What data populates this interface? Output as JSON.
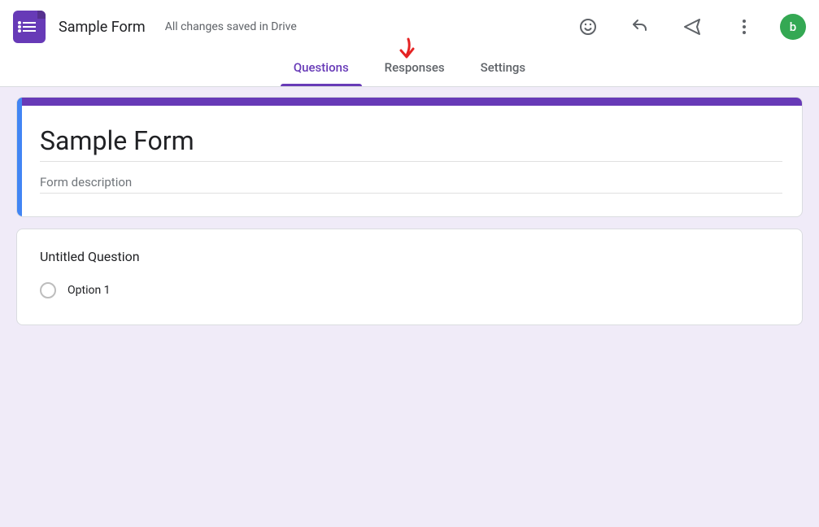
{
  "header": {
    "form_name": "Sample Form",
    "save_status": "All changes saved in Drive",
    "avatar_letter": "b"
  },
  "tabs": {
    "questions": "Questions",
    "responses": "Responses",
    "settings": "Settings"
  },
  "title_card": {
    "title": "Sample Form",
    "description_placeholder": "Form description"
  },
  "question_card": {
    "title": "Untitled Question",
    "option1": "Option 1"
  },
  "colors": {
    "primary": "#673ab7",
    "accent": "#4285f4",
    "avatar": "#34a853"
  },
  "annotation": {
    "type": "hand-drawn-arrow",
    "color": "#e52323",
    "points_to": "responses-tab"
  }
}
